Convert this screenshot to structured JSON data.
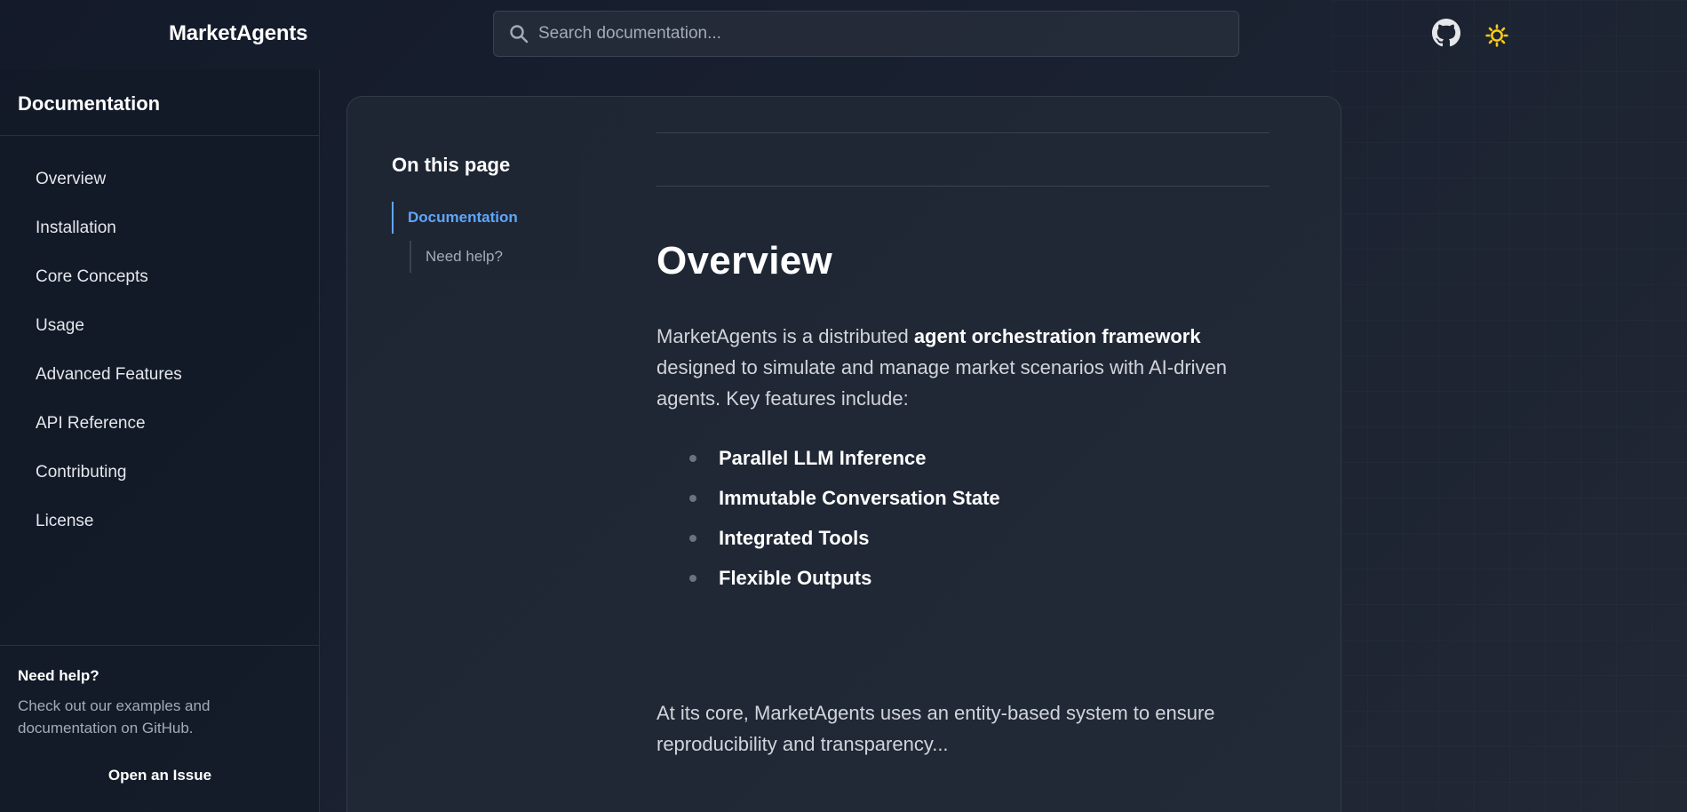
{
  "header": {
    "brand": "MarketAgents",
    "search_placeholder": "Search documentation..."
  },
  "sidebar": {
    "title": "Documentation",
    "items": [
      {
        "label": "Overview"
      },
      {
        "label": "Installation"
      },
      {
        "label": "Core Concepts"
      },
      {
        "label": "Usage"
      },
      {
        "label": "Advanced Features"
      },
      {
        "label": "API Reference"
      },
      {
        "label": "Contributing"
      },
      {
        "label": "License"
      }
    ],
    "help": {
      "title": "Need help?",
      "text": "Check out our examples and documentation on GitHub.",
      "link": "Open an Issue"
    }
  },
  "toc": {
    "title": "On this page",
    "items": [
      {
        "label": "Documentation",
        "active": true
      },
      {
        "label": "Need help?",
        "active": false
      }
    ]
  },
  "main": {
    "heading": "Overview",
    "intro": {
      "pre": "MarketAgents is a distributed ",
      "bold": "agent orchestration framework",
      "post": " designed to simulate and manage market scenarios with AI-driven agents. Key features include:"
    },
    "features": [
      "Parallel LLM Inference",
      "Immutable Conversation State",
      "Integrated Tools",
      "Flexible Outputs"
    ],
    "core_text": "At its core, MarketAgents uses an entity-based system to ensure reproducibility and transparency..."
  },
  "colors": {
    "accent": "#60a5fa",
    "theme_icon": "#facc15",
    "background": "#1b2231"
  },
  "icons": [
    "search-icon",
    "github-icon",
    "sun-icon"
  ]
}
